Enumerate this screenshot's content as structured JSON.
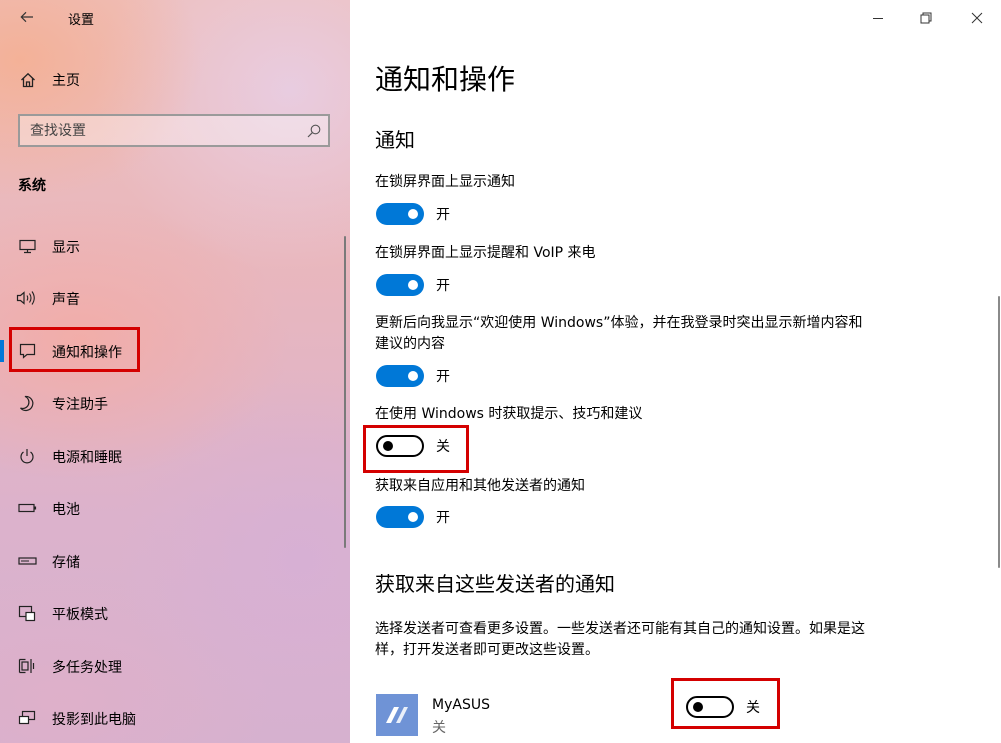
{
  "sidebar": {
    "title": "设置",
    "home_label": "主页",
    "search_placeholder": "查找设置",
    "section_label": "系统",
    "items": [
      {
        "label": "显示",
        "icon": "monitor-icon"
      },
      {
        "label": "声音",
        "icon": "speaker-icon"
      },
      {
        "label": "通知和操作",
        "icon": "notification-icon",
        "active": true
      },
      {
        "label": "专注助手",
        "icon": "moon-icon"
      },
      {
        "label": "电源和睡眠",
        "icon": "power-icon"
      },
      {
        "label": "电池",
        "icon": "battery-icon"
      },
      {
        "label": "存储",
        "icon": "storage-icon"
      },
      {
        "label": "平板模式",
        "icon": "tablet-icon"
      },
      {
        "label": "多任务处理",
        "icon": "multitask-icon"
      },
      {
        "label": "投影到此电脑",
        "icon": "project-icon"
      }
    ]
  },
  "main": {
    "page_title": "通知和操作",
    "notifications_heading": "通知",
    "settings": [
      {
        "label": "在锁屏界面上显示通知",
        "state": "开",
        "on": true
      },
      {
        "label": "在锁屏界面上显示提醒和 VoIP 来电",
        "state": "开",
        "on": true
      },
      {
        "label": "更新后向我显示“欢迎使用 Windows”体验，并在我登录时突出显示新增内容和建议的内容",
        "state": "开",
        "on": true
      },
      {
        "label": "在使用 Windows 时获取提示、技巧和建议",
        "state": "关",
        "on": false
      },
      {
        "label": "获取来自应用和其他发送者的通知",
        "state": "开",
        "on": true
      }
    ],
    "senders_heading": "获取来自这些发送者的通知",
    "senders_desc": "选择发送者可查看更多设置。一些发送者还可能有其自己的通知设置。如果是这样，打开发送者即可更改这些设置。",
    "apps": [
      {
        "name": "MyASUS",
        "status": "关",
        "toggle_state": "关",
        "on": false
      }
    ]
  },
  "colors": {
    "accent": "#0078d7",
    "highlight": "#d40000"
  }
}
